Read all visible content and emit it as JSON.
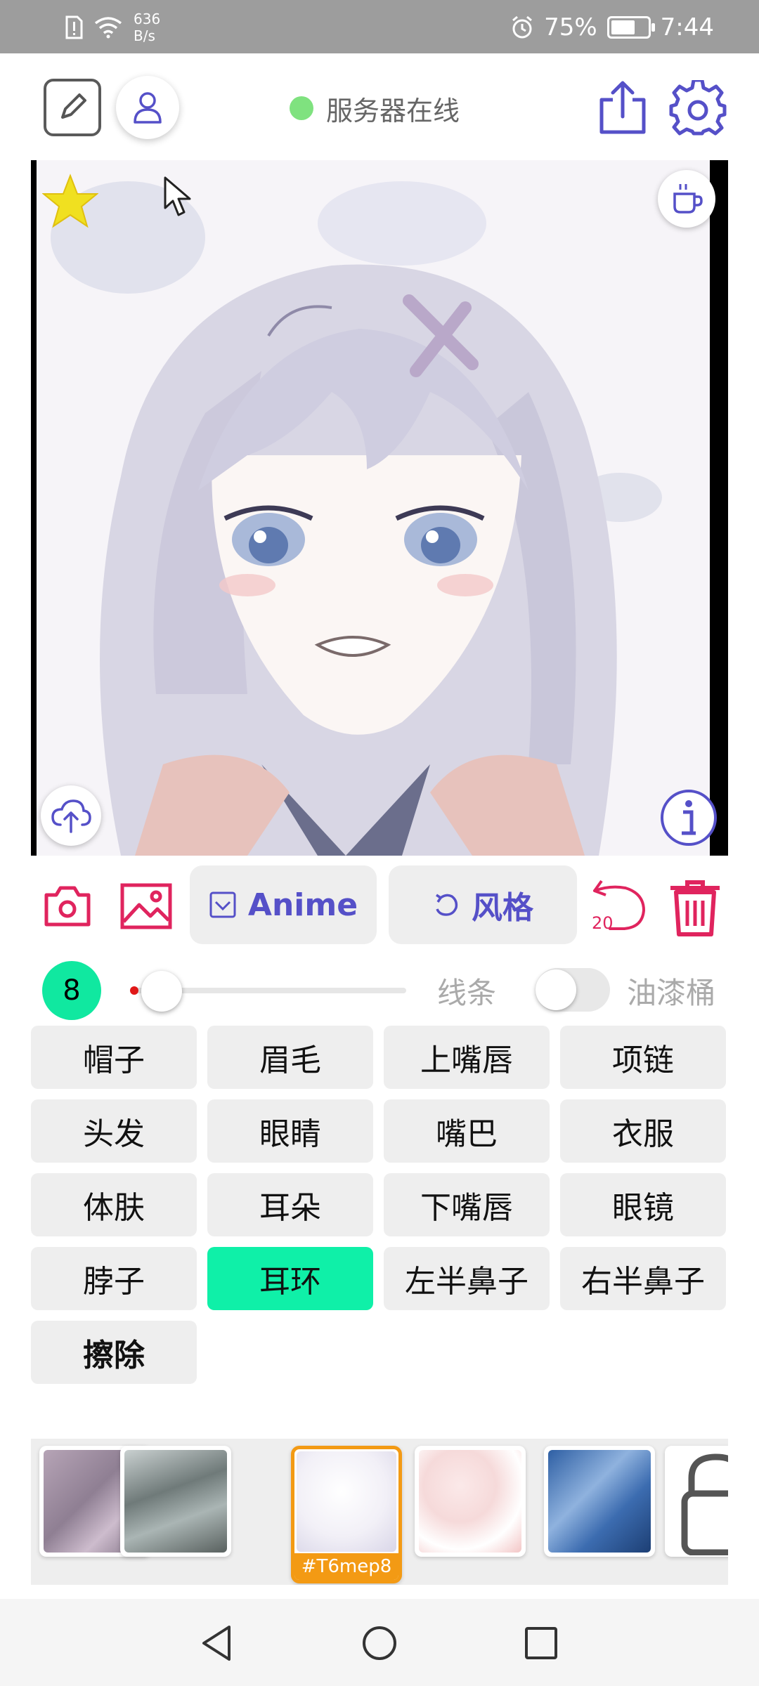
{
  "status_bar": {
    "net_speed_value": "636",
    "net_speed_unit": "B/s",
    "battery": "75%",
    "time": "7:44",
    "battery_level": 0.75
  },
  "header": {
    "server_status": "服务器在线",
    "server_status_color": "#7fe27f"
  },
  "tools": {
    "anime_label": "Anime",
    "style_label": "风格",
    "undo_count": "20"
  },
  "brush": {
    "size": "8",
    "line_label": "线条",
    "bucket_label": "油漆桶",
    "slider_level": 0.02,
    "bucket_enabled": false
  },
  "parts": [
    {
      "label": "帽子"
    },
    {
      "label": "眉毛"
    },
    {
      "label": "上嘴唇"
    },
    {
      "label": "项链"
    },
    {
      "label": "头发"
    },
    {
      "label": "眼睛"
    },
    {
      "label": "嘴巴"
    },
    {
      "label": "衣服"
    },
    {
      "label": "体肤"
    },
    {
      "label": "耳朵"
    },
    {
      "label": "下嘴唇"
    },
    {
      "label": "眼镜"
    },
    {
      "label": "脖子"
    },
    {
      "label": "耳环",
      "active": true
    },
    {
      "label": "左半鼻子"
    },
    {
      "label": "右半鼻子"
    },
    {
      "label": "擦除",
      "bold": true
    }
  ],
  "styles": {
    "selected_tag": "#T6mep8"
  },
  "colors": {
    "accent_purple": "#5550c8",
    "accent_red": "#e0245e",
    "active_green": "#0ff0a8",
    "selected_orange": "#f39a14"
  }
}
